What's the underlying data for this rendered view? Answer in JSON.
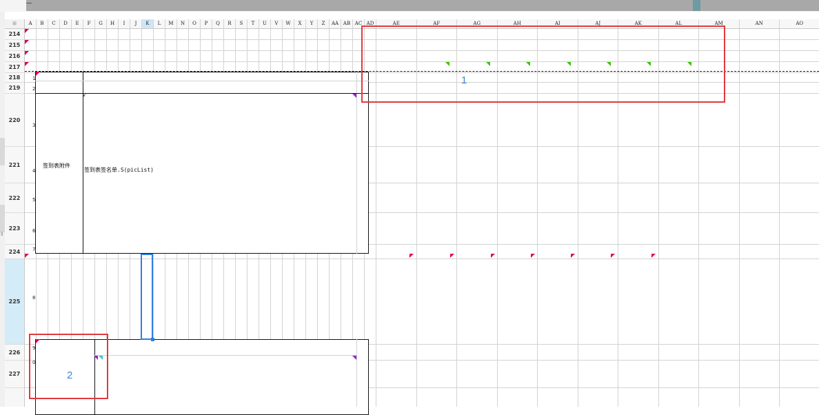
{
  "sheet": {
    "corner_label": "⊞",
    "columns": [
      "A",
      "B",
      "C",
      "D",
      "E",
      "F",
      "G",
      "H",
      "I",
      "J",
      "K",
      "L",
      "M",
      "N",
      "O",
      "P",
      "Q",
      "R",
      "S",
      "T",
      "U",
      "V",
      "W",
      "X",
      "Y",
      "Z",
      "AA",
      "AB",
      "AC",
      "AD",
      "AE",
      "AF",
      "AG",
      "AH",
      "AI",
      "AJ",
      "AK",
      "AL",
      "AM",
      "AN",
      "AO"
    ],
    "selected_column": "K",
    "rows": [
      "214",
      "215",
      "216",
      "217",
      "218",
      "219",
      "220",
      "221",
      "222",
      "223",
      "224",
      "225",
      "226",
      "227"
    ],
    "selected_row": "225",
    "inner_row_numbers": [
      "1",
      "2",
      "3",
      "4",
      "5",
      "6",
      "7",
      "8",
      "9",
      "0"
    ]
  },
  "cells": {
    "attachment_label": "签到表附件",
    "attachment_formula": "签到表签名单.S(picList)",
    "small_marker": "v"
  },
  "annotations": [
    {
      "label": "1",
      "color": "#e0393e",
      "label_color": "#3f83d9"
    },
    {
      "label": "2",
      "color": "#e0393e",
      "label_color": "#3f83d9"
    }
  ],
  "colors": {
    "selection": "#2d7fe0",
    "comment_red": "#e3004f",
    "comment_green": "#35c800",
    "comment_purple": "#9b1fd1",
    "comment_teal": "#38c7c7"
  }
}
